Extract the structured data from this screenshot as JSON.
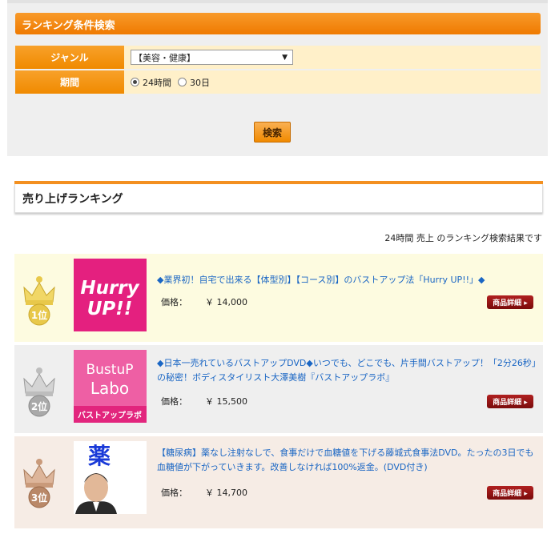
{
  "search": {
    "header": "ランキング条件検索",
    "genre_label": "ジャンル",
    "genre_selected": "【美容・健康】",
    "period_label": "期間",
    "period_options": [
      "24時間",
      "30日"
    ],
    "period_selected": "24時間",
    "button": "検索"
  },
  "ranking": {
    "title": "売り上げランキング",
    "caption": "24時間 売上 のランキング検索結果です",
    "price_label": "価格：",
    "detail_label": "商品詳細 ▸",
    "items": [
      {
        "rank_badge": "1位",
        "thumb_text_1": "Hurry",
        "thumb_text_2": "UP!!",
        "title": "◆業界初！自宅で出来る【体型別】【コース別】のバストアップ法「Hurry UP!!」◆",
        "price": "￥ 14,000"
      },
      {
        "rank_badge": "2位",
        "thumb_text_1": "BustuP",
        "thumb_text_2": "Labo",
        "thumb_text_3": "バストアップラボ",
        "title": "◆日本一売れているバストアップDVD◆いつでも、どこでも、片手間バストアップ！「2分26秒」の秘密！ボディスタイリスト大澤美樹『バストアップラボ』",
        "price": "￥ 15,500"
      },
      {
        "rank_badge": "3位",
        "thumb_text_1": "薬",
        "title": "【糖尿病】薬なし注射なしで、食事だけで血糖値を下げる藤城式食事法DVD。たったの3日でも血糖値が下がっていきます。改善しなければ100%返金。(DVD付き)",
        "price": "￥ 14,700"
      }
    ]
  },
  "colors": {
    "accent_orange": "#f08a00",
    "link_blue": "#1a66c4",
    "detail_red": "#9a1414",
    "gold": "#e8c84a",
    "silver": "#bdbdbd",
    "bronze": "#c99a7a"
  }
}
